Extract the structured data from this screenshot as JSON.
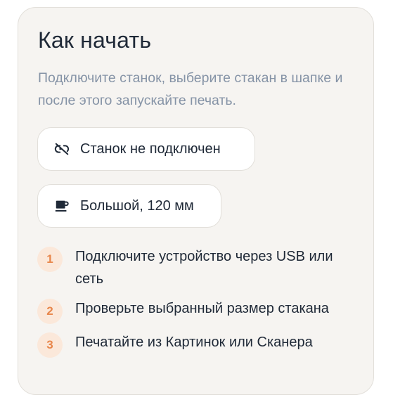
{
  "card": {
    "title": "Как начать",
    "subtitle": "Подключите станок, выберите стакан в шапке и после этого запускайте печать."
  },
  "status_pill": {
    "icon": "link-off-icon",
    "label": "Станок не подключен"
  },
  "cup_pill": {
    "icon": "coffee-cup-icon",
    "label": "Большой, 120 мм"
  },
  "steps": [
    {
      "number": "1",
      "text": "Подключите устройство через USB или сеть"
    },
    {
      "number": "2",
      "text": "Проверьте выбранный размер стакана"
    },
    {
      "number": "3",
      "text": "Печатайте из Картинок или Сканера"
    }
  ],
  "colors": {
    "card_background": "#f6f4f1",
    "title_text": "#1f2937",
    "subtitle_text": "#8593a6",
    "step_badge_background": "#fbe8da",
    "step_badge_text": "#e8874c"
  }
}
